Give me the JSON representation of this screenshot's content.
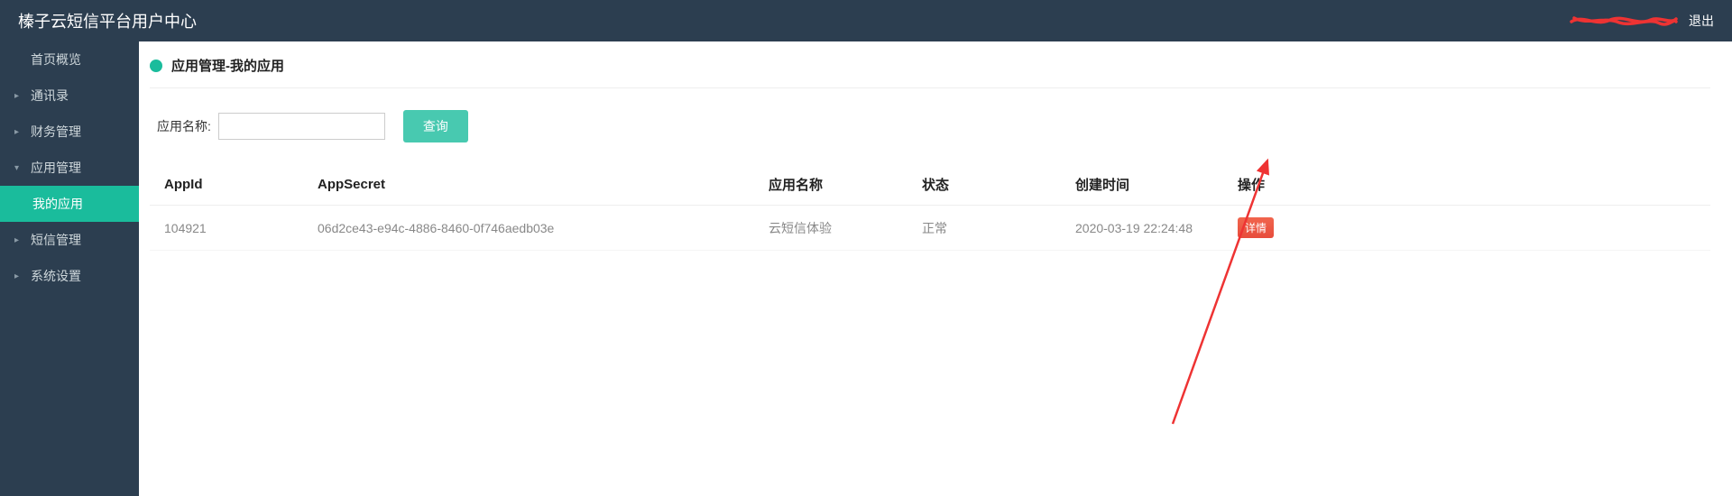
{
  "header": {
    "title": "榛子云短信平台用户中心",
    "logout": "退出"
  },
  "sidebar": {
    "items": [
      {
        "label": "首页概览",
        "caret": "",
        "active": false,
        "sub": false
      },
      {
        "label": "通讯录",
        "caret": "▸",
        "active": false,
        "sub": false
      },
      {
        "label": "财务管理",
        "caret": "▸",
        "active": false,
        "sub": false
      },
      {
        "label": "应用管理",
        "caret": "▾",
        "active": false,
        "sub": false
      },
      {
        "label": "我的应用",
        "caret": "",
        "active": true,
        "sub": true
      },
      {
        "label": "短信管理",
        "caret": "▸",
        "active": false,
        "sub": false
      },
      {
        "label": "系统设置",
        "caret": "▸",
        "active": false,
        "sub": false
      }
    ]
  },
  "panel": {
    "title": "应用管理-我的应用"
  },
  "filter": {
    "label": "应用名称:",
    "value": "",
    "query_button": "查询"
  },
  "table": {
    "headers": {
      "appid": "AppId",
      "secret": "AppSecret",
      "name": "应用名称",
      "status": "状态",
      "created": "创建时间",
      "action": "操作"
    },
    "rows": [
      {
        "appid": "104921",
        "secret": "06d2ce43-e94c-4886-8460-0f746aedb03e",
        "name": "云短信体验",
        "status": "正常",
        "created": "2020-03-19 22:24:48",
        "action": "详情"
      }
    ]
  }
}
